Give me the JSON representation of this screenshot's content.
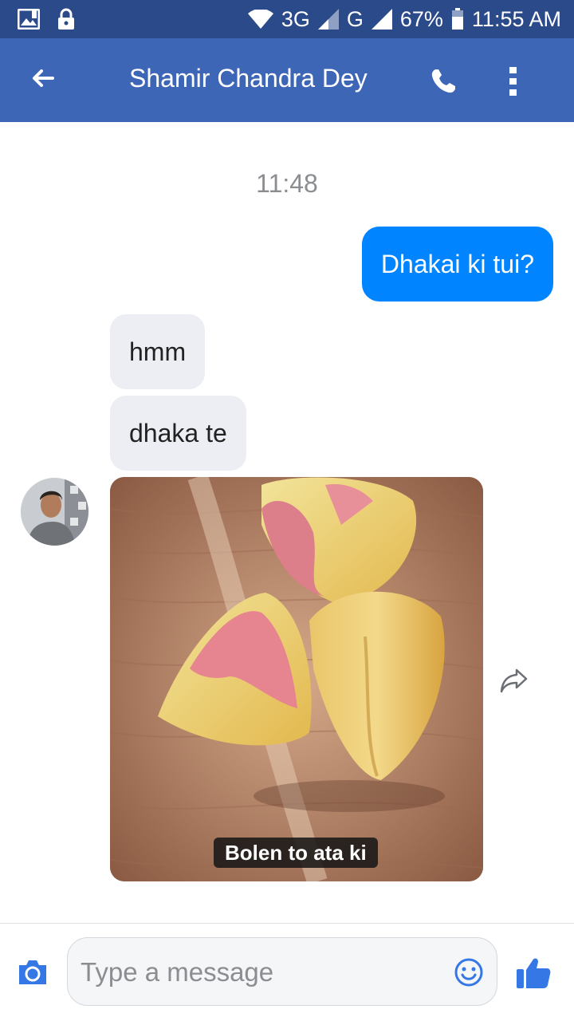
{
  "status_bar": {
    "network_3g": "3G",
    "network_g": "G",
    "battery": "67%",
    "time": "11:55 AM"
  },
  "header": {
    "contact_name": "Shamir Chandra Dey"
  },
  "conversation": {
    "timestamp": "11:48",
    "messages": [
      {
        "direction": "outgoing",
        "text": "Dhakai ki tui?"
      },
      {
        "direction": "incoming",
        "text": "hmm"
      },
      {
        "direction": "incoming",
        "text": "dhaka te"
      }
    ],
    "photo_caption": "Bolen to ata ki"
  },
  "composer": {
    "placeholder": "Type a message"
  },
  "colors": {
    "status_bar": "#2b4a8a",
    "app_bar": "#3d66b7",
    "outgoing_bubble": "#0084ff",
    "incoming_bubble": "#eceef3",
    "icon_blue": "#3578e5"
  },
  "icons": [
    "image-icon",
    "lock-icon",
    "wifi-icon",
    "signal-icon",
    "battery-icon",
    "back-arrow-icon",
    "phone-icon",
    "more-vert-icon",
    "share-icon",
    "camera-icon",
    "smiley-icon",
    "thumbs-up-icon"
  ]
}
